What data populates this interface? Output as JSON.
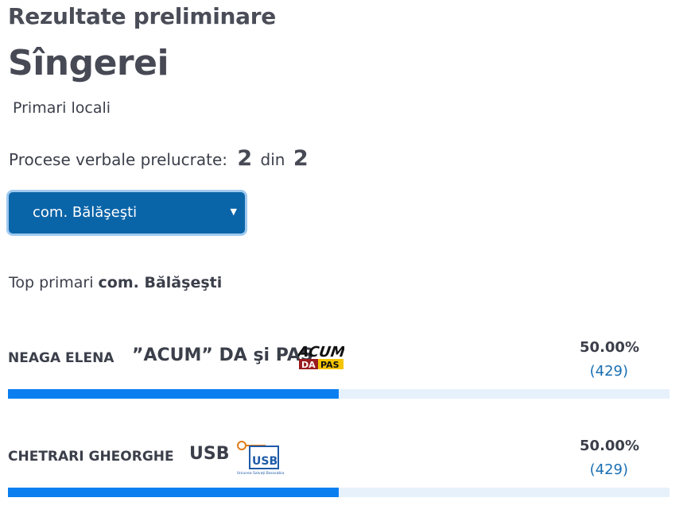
{
  "header": {
    "subtitle": "Rezultate preliminare",
    "city": "Sîngerei",
    "election_type": "Primari locali"
  },
  "processed": {
    "label": "Procese verbale prelucrate:",
    "done": "2",
    "separator": "din",
    "total": "2"
  },
  "locality_select": {
    "value": "com. Bălăşeşti"
  },
  "top": {
    "prefix": "Top primari",
    "locality": "com. Bălăşeşti"
  },
  "candidates": [
    {
      "name": "NEAGA ELENA",
      "party": "”ACUM” DA şi PAS",
      "logo": "acum-da-pas-logo",
      "logo_text_top": "ACUM",
      "logo_text_bottom_left": "DA",
      "logo_text_bottom_right": "PAS",
      "percent_text": "50.00%",
      "votes_text": "(429)",
      "share": 0.5
    },
    {
      "name": "CHETRARI GHEORGHE",
      "party": "USB",
      "logo": "usb-logo",
      "logo_text": "USB",
      "logo_caption": "Uniunea Salvaţi Basarabia",
      "percent_text": "50.00%",
      "votes_text": "(429)",
      "share": 0.5
    }
  ],
  "colors": {
    "select_bg": "#0a64a8",
    "bar_fill": "#0b7ff0",
    "bar_track": "#e6f1fb",
    "votes_link": "#1a6fb3"
  }
}
